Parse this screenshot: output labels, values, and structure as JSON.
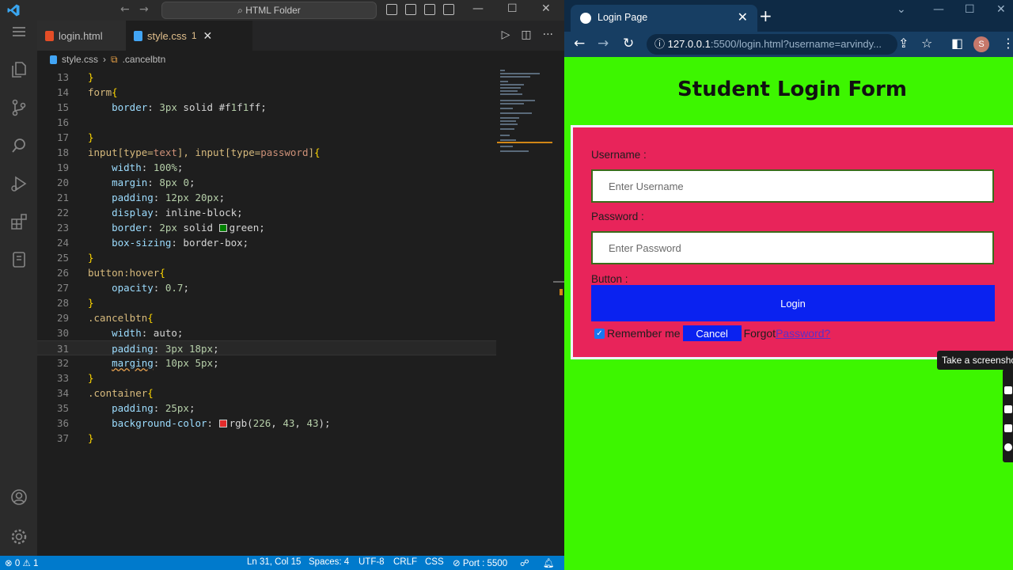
{
  "vscode": {
    "search_text": "HTML Folder",
    "tabs": [
      {
        "label": "login.html"
      },
      {
        "label": "style.css",
        "badge": "1"
      }
    ],
    "breadcrumb": {
      "file": "style.css",
      "symbol": ".cancelbtn"
    },
    "code_lines": [
      {
        "n": "13",
        "text": "}"
      },
      {
        "n": "14",
        "text": "form{"
      },
      {
        "n": "15",
        "text": "    border: 3px solid #f1f1ff;"
      },
      {
        "n": "16",
        "text": ""
      },
      {
        "n": "17",
        "text": "}"
      },
      {
        "n": "18",
        "text": "input[type=text], input[type=password]{"
      },
      {
        "n": "19",
        "text": "    width: 100%;"
      },
      {
        "n": "20",
        "text": "    margin: 8px 0;"
      },
      {
        "n": "21",
        "text": "    padding: 12px 20px;"
      },
      {
        "n": "22",
        "text": "    display: inline-block;"
      },
      {
        "n": "23",
        "text": "    border: 2px solid green;"
      },
      {
        "n": "24",
        "text": "    box-sizing: border-box;"
      },
      {
        "n": "25",
        "text": "}"
      },
      {
        "n": "26",
        "text": "button:hover{"
      },
      {
        "n": "27",
        "text": "    opacity: 0.7;"
      },
      {
        "n": "28",
        "text": "}"
      },
      {
        "n": "29",
        "text": ".cancelbtn{"
      },
      {
        "n": "30",
        "text": "    width: auto;"
      },
      {
        "n": "31",
        "text": "    padding: 3px 18px;"
      },
      {
        "n": "32",
        "text": "    marging: 10px 5px;"
      },
      {
        "n": "33",
        "text": "}"
      },
      {
        "n": "34",
        "text": ".container{"
      },
      {
        "n": "35",
        "text": "    padding: 25px;"
      },
      {
        "n": "36",
        "text": "    background-color: rgb(226, 43, 43);"
      },
      {
        "n": "37",
        "text": "}"
      }
    ],
    "status": {
      "errors": "0",
      "warnings": "1",
      "position": "Ln 31, Col 15",
      "spaces": "Spaces: 4",
      "encoding": "UTF-8",
      "eol": "CRLF",
      "language": "CSS",
      "port": "Port : 5500"
    },
    "colors": {
      "status_bar": "#007acc",
      "editor_bg": "#1e1e1e"
    }
  },
  "browser": {
    "tab_title": "Login Page",
    "url_host": "127.0.0.1",
    "url_rest": ":5500/login.html?username=arvindy...",
    "avatar_letter": "S",
    "page": {
      "title": "Student Login Form",
      "username_label": "Username :",
      "username_placeholder": "Enter Username",
      "password_label": "Password :",
      "password_placeholder": "Enter Password",
      "button_label": "Button :",
      "login_button": "Login",
      "remember_me": "Remember me",
      "cancel_button": "Cancel",
      "forgot_text": "Forgot",
      "password_link": "Password?"
    },
    "colors": {
      "page_bg": "#3df600",
      "form_bg": "#e8245a",
      "button_bg": "#0a22f0"
    }
  },
  "tooltip": {
    "text": "Take a screensho"
  }
}
